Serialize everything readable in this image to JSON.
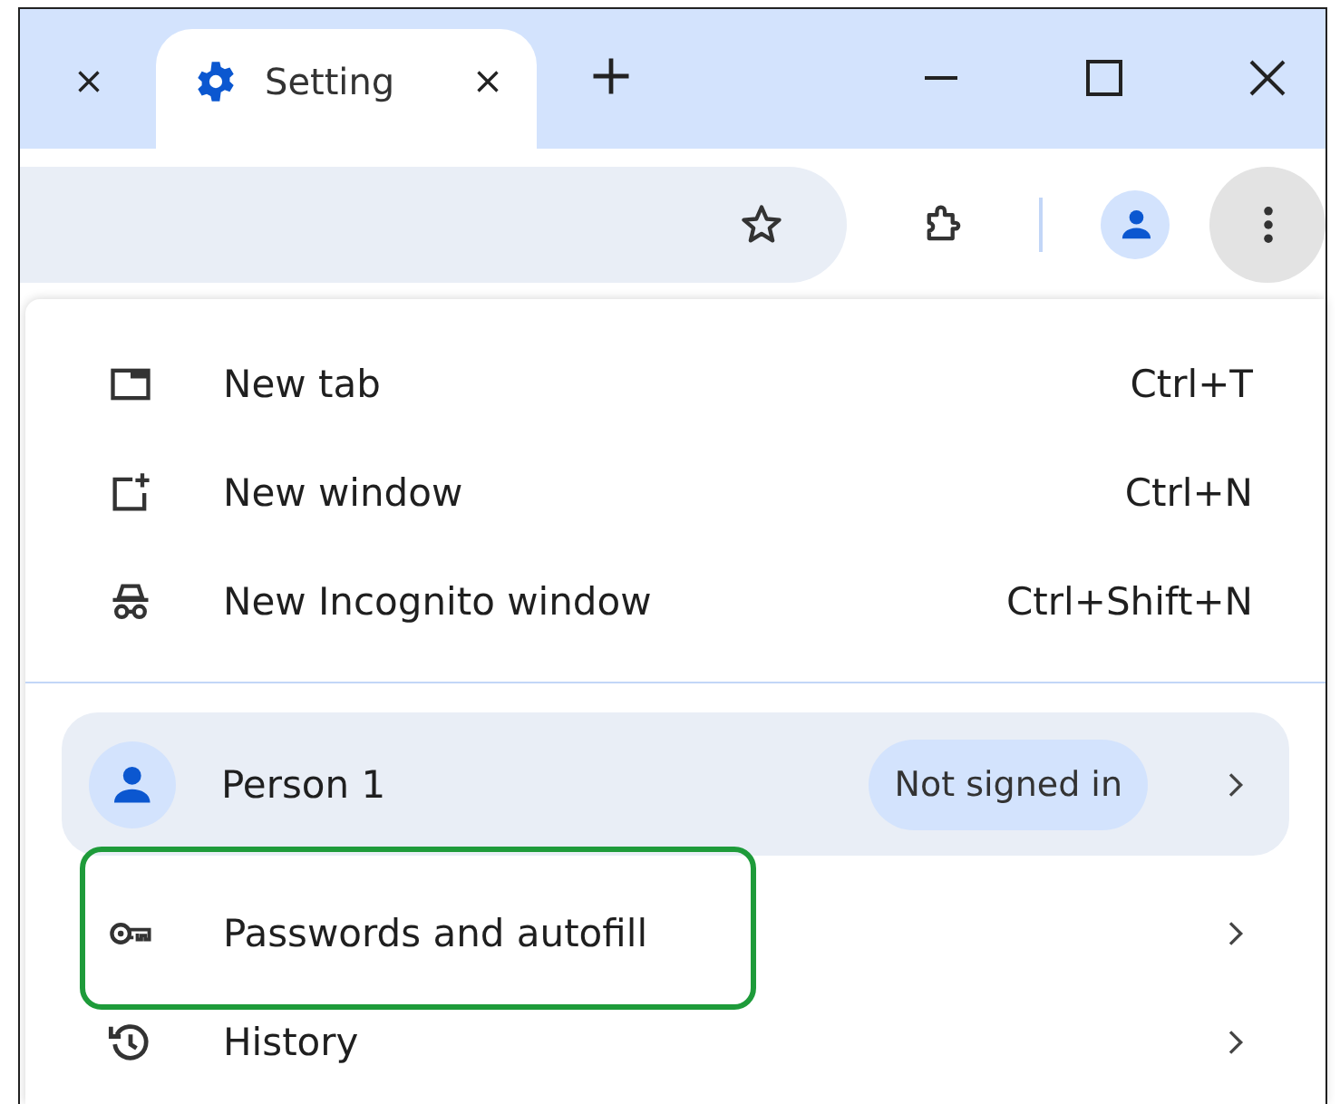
{
  "tabs": [
    {
      "selected": false
    },
    {
      "title": "Setting",
      "selected": true
    }
  ],
  "menu": {
    "items": [
      {
        "kind": "command",
        "label": "New tab",
        "shortcut": "Ctrl+T"
      },
      {
        "kind": "command",
        "label": "New window",
        "shortcut": "Ctrl+N"
      },
      {
        "kind": "command",
        "label": "New Incognito window",
        "shortcut": "Ctrl+Shift+N"
      },
      {
        "kind": "divider"
      },
      {
        "kind": "profile",
        "label": "Person 1",
        "badge": "Not signed in"
      },
      {
        "kind": "submenu",
        "label": "Passwords and autofill",
        "highlighted": true
      },
      {
        "kind": "submenu",
        "label": "History",
        "highlighted": false
      }
    ]
  }
}
